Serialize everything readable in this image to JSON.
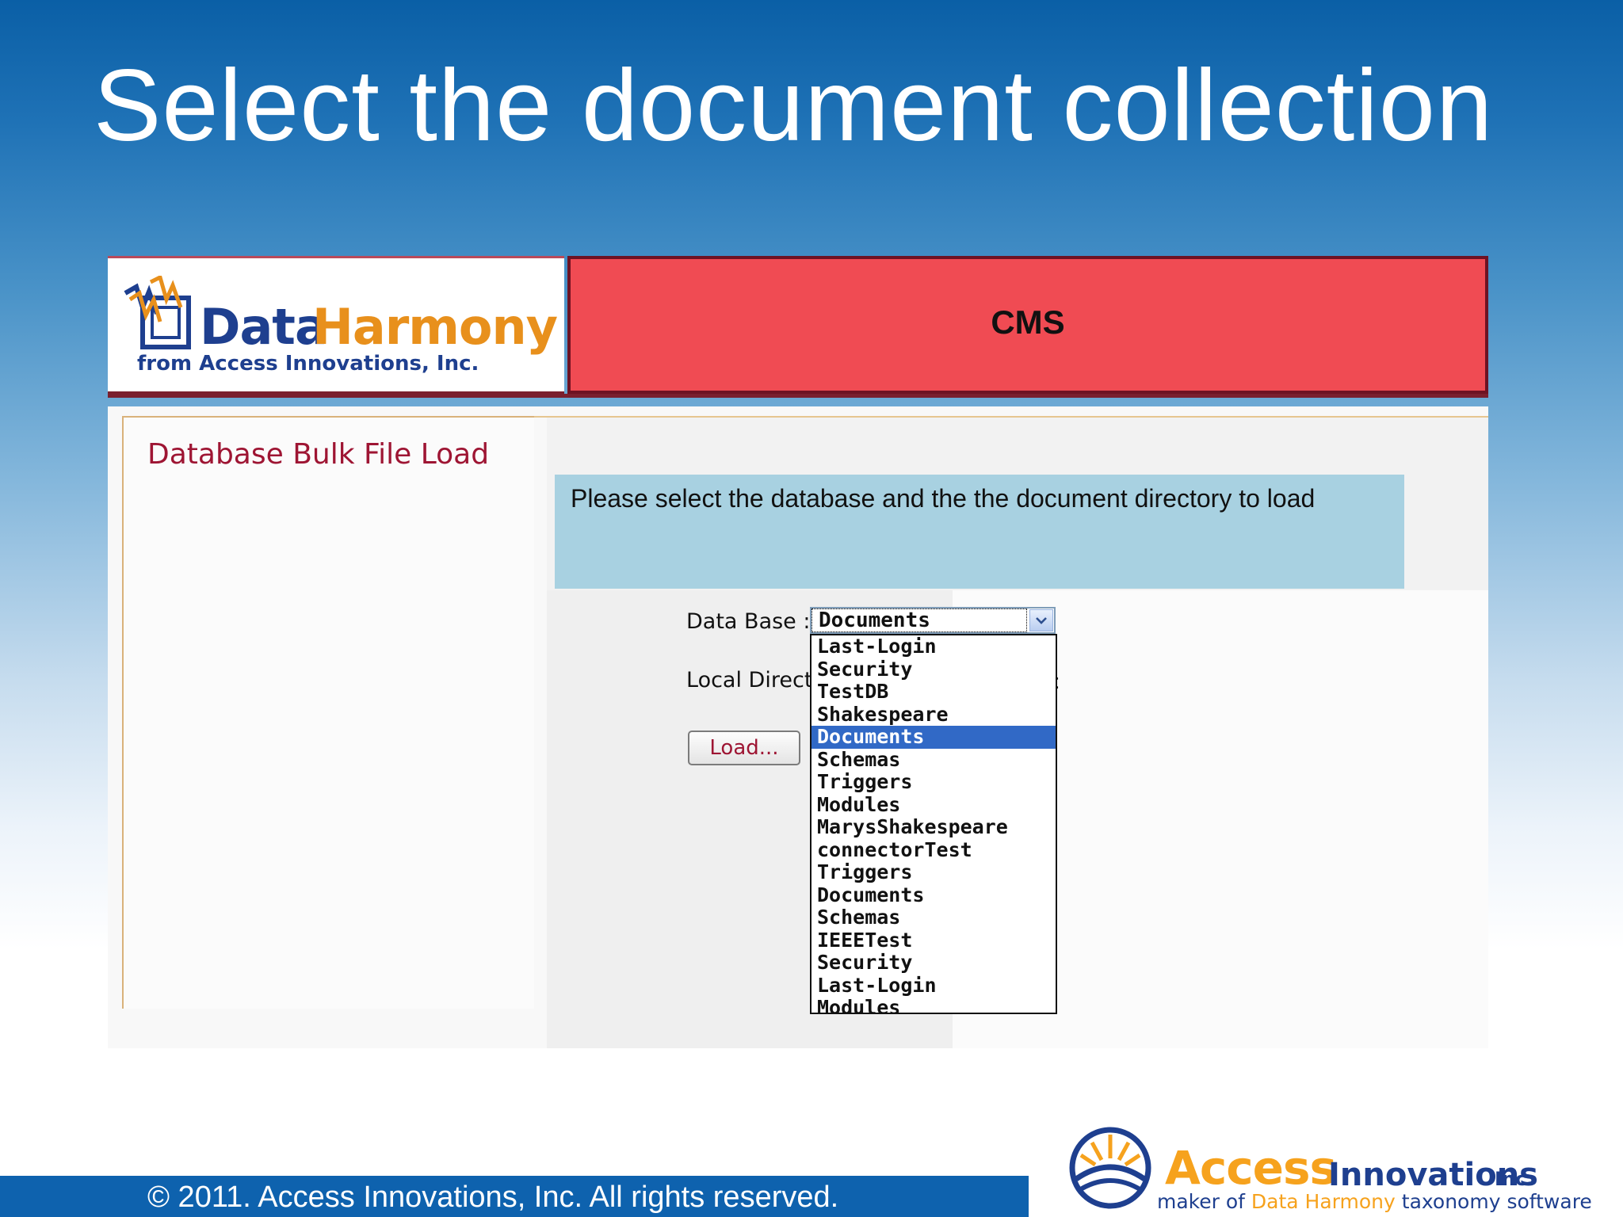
{
  "slide": {
    "title": "Select the document collection",
    "footer": "© 2011. Access Innovations, Inc.  All rights reserved."
  },
  "app": {
    "logo": {
      "word1": "Data",
      "word2": "Harmony",
      "tagline": "from Access Innovations, Inc."
    },
    "banner": "CMS",
    "page_title": "Database Bulk File Load",
    "instruction": "Please select the database and the the document directory to load",
    "form": {
      "database_label": "Data Base :",
      "directory_label": "Local Direct",
      "directory_tail": ":",
      "load_button": "Load...",
      "selected_database": "Documents",
      "options": [
        "Last-Login",
        "Security",
        "TestDB",
        "Shakespeare",
        "Documents",
        "Schemas",
        "Triggers",
        "Modules",
        "MarysShakespeare",
        "connectorTest",
        "Triggers",
        "Documents",
        "Schemas",
        "IEEETest",
        "Security",
        "Last-Login",
        "Modules"
      ],
      "highlighted_index": 4
    }
  },
  "brand": {
    "access": "Access",
    "innovations": "Innovations",
    "inc": "Inc.",
    "tagline_pre": "maker of",
    "tagline_highlight": "Data Harmony",
    "tagline_post": "taxonomy software"
  },
  "colors": {
    "banner": "#f04b53",
    "info_box": "#a8d1e1",
    "selection": "#3169c6",
    "title_red": "#9e1533",
    "footer_blue": "#0e62ae"
  }
}
